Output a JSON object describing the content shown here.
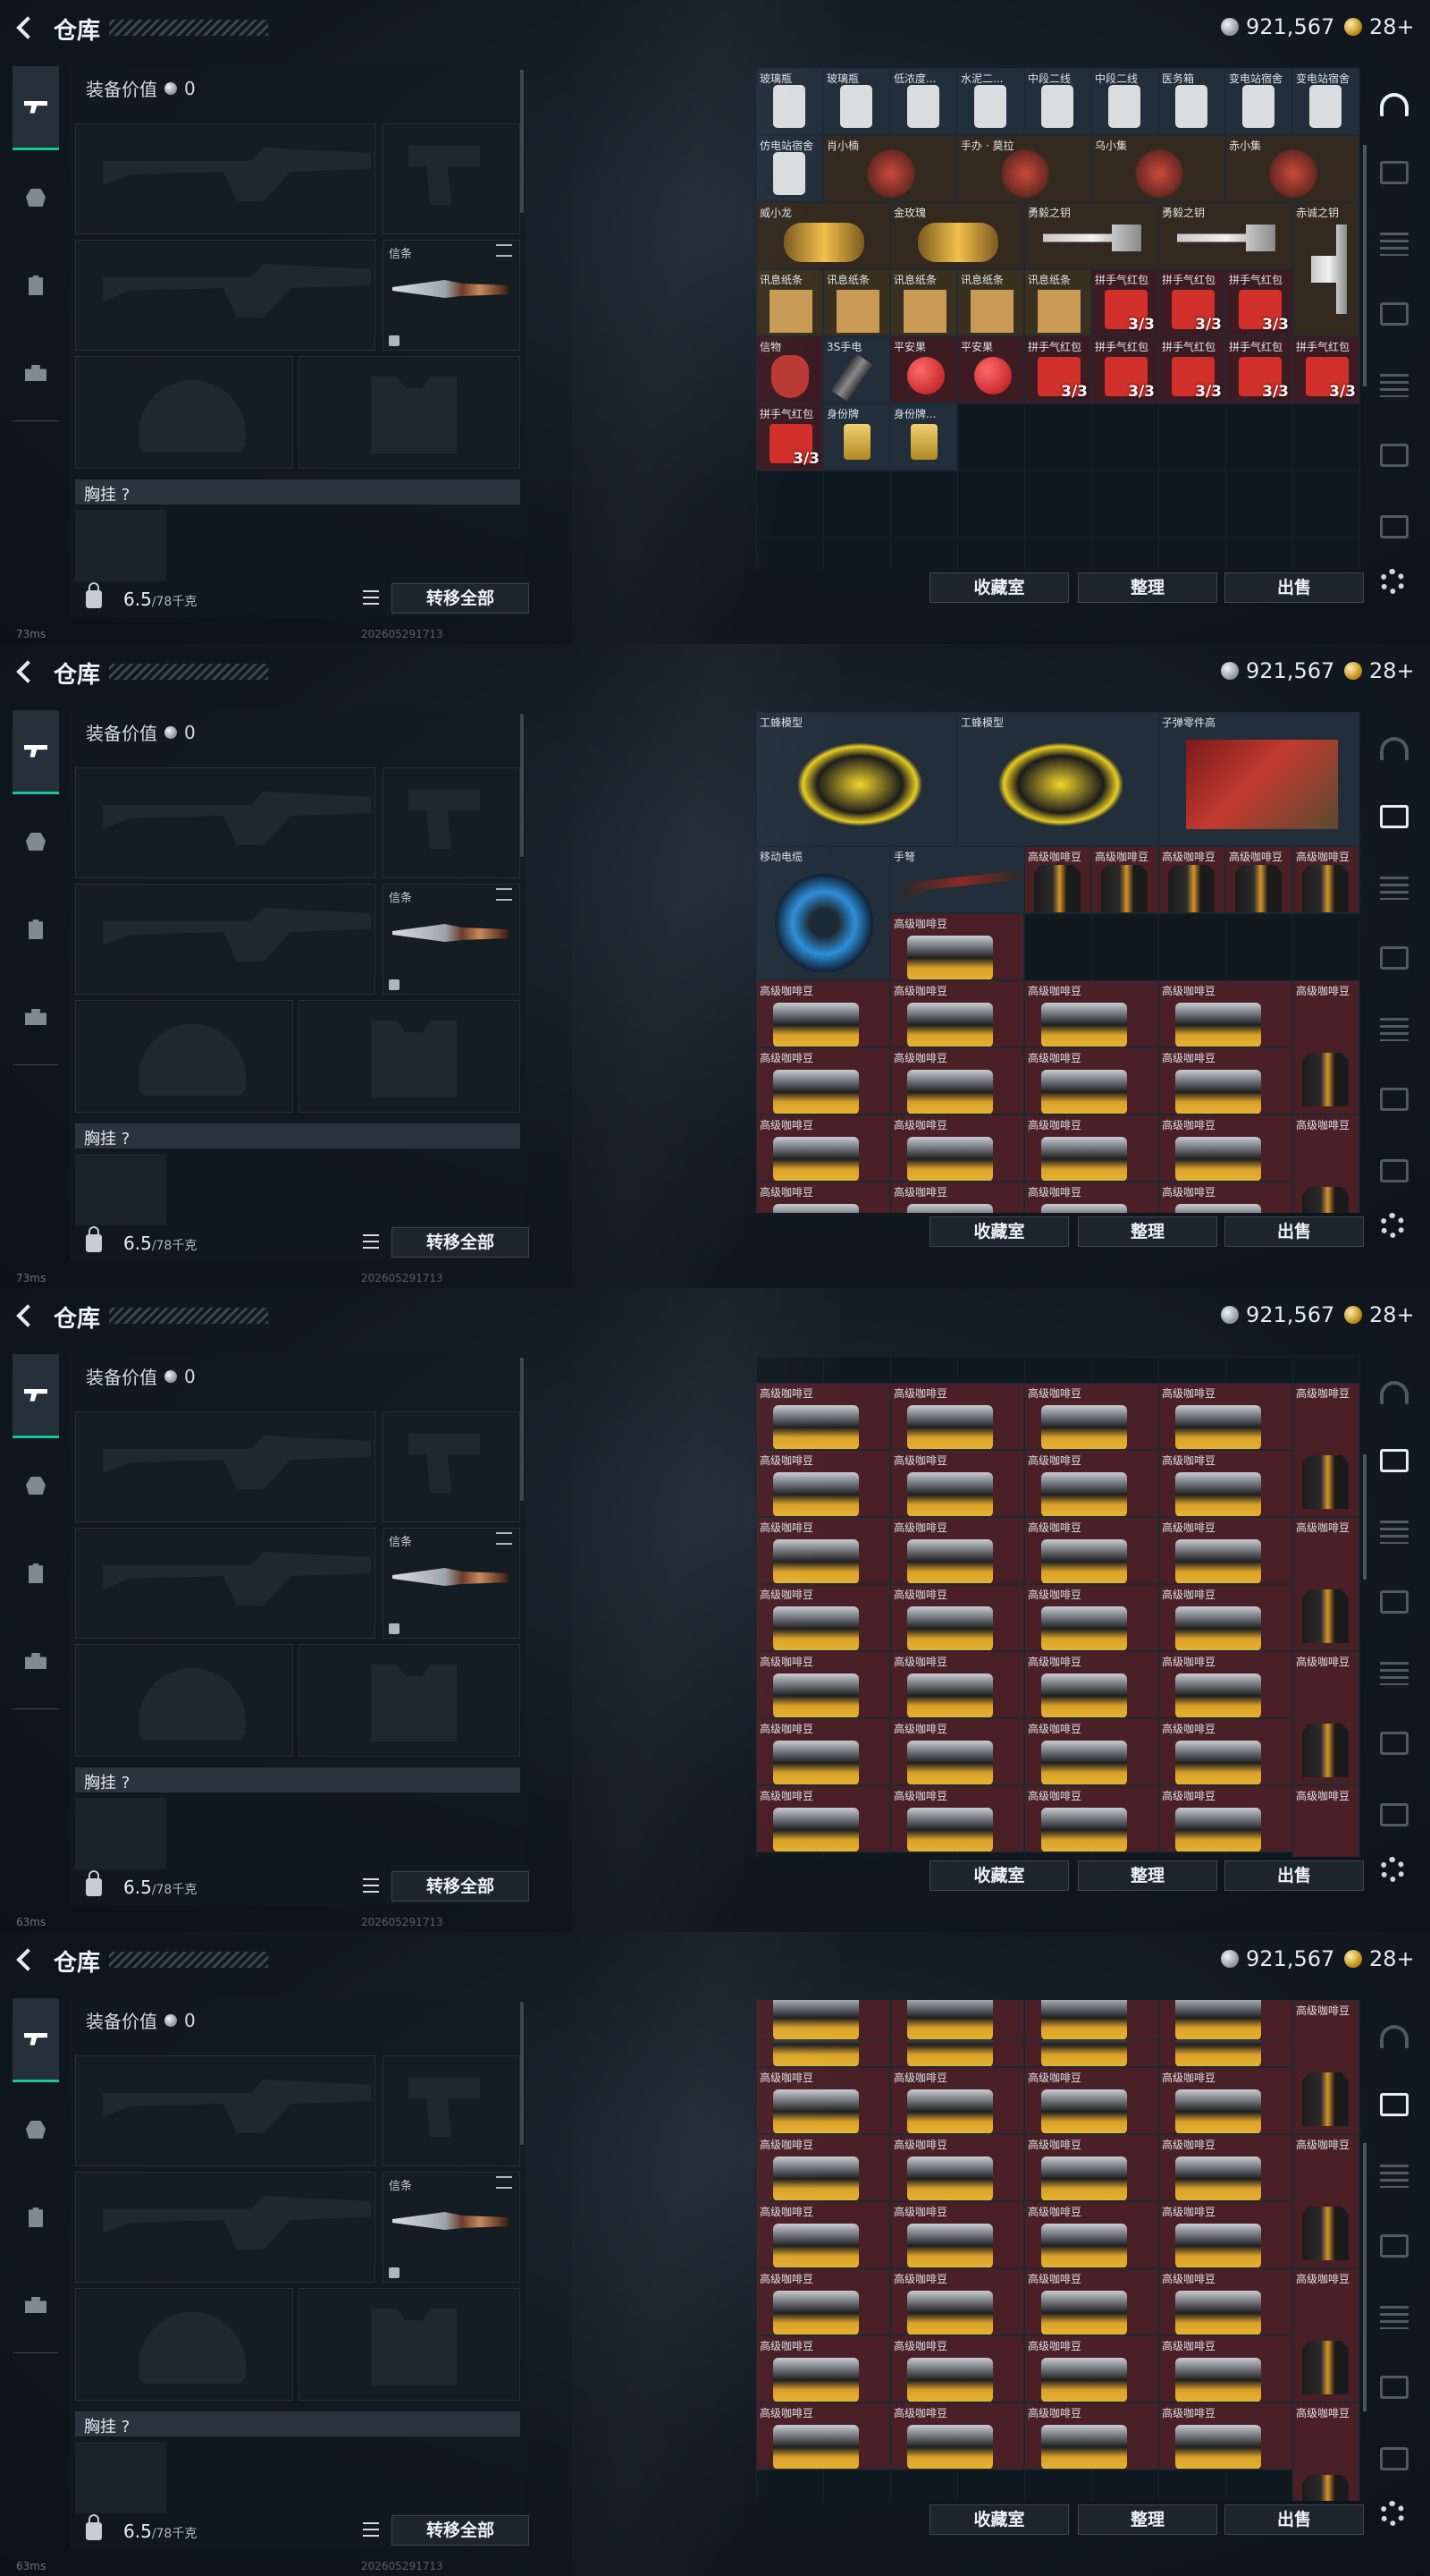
{
  "header": {
    "title": "仓库",
    "silver": "921,567",
    "gold": "28+"
  },
  "loadout": {
    "value_label": "装备价值",
    "value": "0",
    "melee_label": "信条",
    "chest_label": "胸挂 ?",
    "weight": "6.5",
    "weight_max": "/78千克",
    "transfer_all": "转移全部"
  },
  "footer": {
    "collection": "收藏室",
    "organize": "整理",
    "sell": "出售"
  },
  "status": {
    "ping": [
      "73ms",
      "73ms",
      "63ms",
      "63ms"
    ],
    "serial": "202605291713"
  },
  "stash_pages": [
    {
      "items": [
        {
          "name": "玻璃瓶",
          "r": 0,
          "c": 0,
          "kind": "bottle"
        },
        {
          "name": "玻璃瓶",
          "r": 0,
          "c": 1,
          "kind": "bottle"
        },
        {
          "name": "低浓度...",
          "r": 0,
          "c": 2,
          "kind": "bottle"
        },
        {
          "name": "水泥二...",
          "r": 0,
          "c": 3,
          "kind": "bottle"
        },
        {
          "name": "中段二线",
          "r": 0,
          "c": 4,
          "kind": "bottle"
        },
        {
          "name": "中段二线",
          "r": 0,
          "c": 5,
          "kind": "bottle"
        },
        {
          "name": "医务箱",
          "r": 0,
          "c": 6,
          "kind": "bottle"
        },
        {
          "name": "变电站宿舍",
          "r": 0,
          "c": 7,
          "kind": "bottle"
        },
        {
          "name": "变电站宿舍",
          "r": 0,
          "c": 8,
          "kind": "bottle"
        },
        {
          "name": "仿电站宿舍",
          "r": 1,
          "c": 0,
          "kind": "bottle"
        },
        {
          "name": "肖小楠",
          "r": 1,
          "c": 1,
          "w": 2,
          "kind": "figure"
        },
        {
          "name": "手办 · 莫拉",
          "r": 1,
          "c": 3,
          "w": 2,
          "kind": "figure"
        },
        {
          "name": "乌小集",
          "r": 1,
          "c": 5,
          "w": 2,
          "kind": "figure"
        },
        {
          "name": "赤小集",
          "r": 1,
          "c": 7,
          "w": 2,
          "kind": "figure"
        },
        {
          "name": "威小龙",
          "r": 2,
          "c": 0,
          "w": 2,
          "kind": "gold"
        },
        {
          "name": "金玫瑰",
          "r": 2,
          "c": 2,
          "w": 2,
          "kind": "gold"
        },
        {
          "name": "勇毅之钥",
          "r": 2,
          "c": 4,
          "w": 2,
          "kind": "key"
        },
        {
          "name": "勇毅之钥",
          "r": 2,
          "c": 6,
          "w": 2,
          "kind": "key"
        },
        {
          "name": "赤诚之钥",
          "r": 2,
          "c": 8,
          "h": 2,
          "kind": "key"
        },
        {
          "name": "讯息纸条",
          "r": 3,
          "c": 0,
          "kind": "paper"
        },
        {
          "name": "讯息纸条",
          "r": 3,
          "c": 1,
          "kind": "paper"
        },
        {
          "name": "讯息纸条",
          "r": 3,
          "c": 2,
          "kind": "paper"
        },
        {
          "name": "讯息纸条",
          "r": 3,
          "c": 3,
          "kind": "paper"
        },
        {
          "name": "讯息纸条",
          "r": 3,
          "c": 4,
          "kind": "paper"
        },
        {
          "name": "拼手气红包",
          "r": 3,
          "c": 5,
          "kind": "red",
          "count": "3/3"
        },
        {
          "name": "拼手气红包",
          "r": 3,
          "c": 6,
          "kind": "red",
          "count": "3/3"
        },
        {
          "name": "拼手气红包",
          "r": 3,
          "c": 7,
          "kind": "red",
          "count": "3/3"
        },
        {
          "name": "信物",
          "r": 4,
          "c": 0,
          "kind": "mask"
        },
        {
          "name": "3S手电",
          "r": 4,
          "c": 1,
          "kind": "torch"
        },
        {
          "name": "平安果",
          "r": 4,
          "c": 2,
          "kind": "apple"
        },
        {
          "name": "平安果",
          "r": 4,
          "c": 3,
          "kind": "apple"
        },
        {
          "name": "拼手气红包",
          "r": 4,
          "c": 4,
          "kind": "red",
          "count": "3/3"
        },
        {
          "name": "拼手气红包",
          "r": 4,
          "c": 5,
          "kind": "red",
          "count": "3/3"
        },
        {
          "name": "拼手气红包",
          "r": 4,
          "c": 6,
          "kind": "red",
          "count": "3/3"
        },
        {
          "name": "拼手气红包",
          "r": 4,
          "c": 7,
          "kind": "red",
          "count": "3/3"
        },
        {
          "name": "拼手气红包",
          "r": 4,
          "c": 8,
          "kind": "red",
          "count": "3/3"
        },
        {
          "name": "拼手气红包",
          "r": 5,
          "c": 0,
          "kind": "red",
          "count": "3/3"
        },
        {
          "name": "身份牌",
          "r": 5,
          "c": 1,
          "kind": "tag"
        },
        {
          "name": "身份牌...",
          "r": 5,
          "c": 2,
          "kind": "tag"
        }
      ]
    },
    {
      "items": [
        {
          "name": "工蜂模型",
          "r": 0,
          "c": 0,
          "w": 3,
          "h": 2,
          "kind": "wasp"
        },
        {
          "name": "工蜂模型",
          "r": 0,
          "c": 3,
          "w": 3,
          "h": 2,
          "kind": "wasp"
        },
        {
          "name": "子弹零件高",
          "r": 0,
          "c": 6,
          "w": 3,
          "h": 2,
          "kind": "parts"
        },
        {
          "name": "移动电缆",
          "r": 2,
          "c": 0,
          "w": 2,
          "h": 2,
          "kind": "reel"
        },
        {
          "name": "手弩",
          "r": 2,
          "c": 2,
          "w": 2,
          "kind": "crossbow"
        },
        {
          "name": "高级咖啡豆",
          "r": 2,
          "c": 4,
          "kind": "bag"
        },
        {
          "name": "高级咖啡豆",
          "r": 2,
          "c": 5,
          "kind": "bag"
        },
        {
          "name": "高级咖啡豆",
          "r": 2,
          "c": 6,
          "kind": "bag"
        },
        {
          "name": "高级咖啡豆",
          "r": 2,
          "c": 7,
          "kind": "bag"
        },
        {
          "name": "高级咖啡豆",
          "r": 2,
          "c": 8,
          "kind": "bag"
        },
        {
          "name": "高级咖啡豆",
          "r": 3,
          "c": 2,
          "w": 2,
          "kind": "bean"
        },
        {
          "name": "高级咖啡豆",
          "r": 4,
          "c": 0,
          "w": 2,
          "kind": "bean"
        },
        {
          "name": "高级咖啡豆",
          "r": 4,
          "c": 2,
          "w": 2,
          "kind": "bean"
        },
        {
          "name": "高级咖啡豆",
          "r": 4,
          "c": 4,
          "w": 2,
          "kind": "bean"
        },
        {
          "name": "高级咖啡豆",
          "r": 4,
          "c": 6,
          "w": 2,
          "kind": "bean"
        },
        {
          "name": "高级咖啡豆",
          "r": 4,
          "c": 8,
          "h": 2,
          "kind": "bag"
        },
        {
          "name": "高级咖啡豆",
          "r": 5,
          "c": 0,
          "w": 2,
          "kind": "bean"
        },
        {
          "name": "高级咖啡豆",
          "r": 5,
          "c": 2,
          "w": 2,
          "kind": "bean"
        },
        {
          "name": "高级咖啡豆",
          "r": 5,
          "c": 4,
          "w": 2,
          "kind": "bean"
        },
        {
          "name": "高级咖啡豆",
          "r": 5,
          "c": 6,
          "w": 2,
          "kind": "bean"
        },
        {
          "name": "高级咖啡豆",
          "r": 6,
          "c": 0,
          "w": 2,
          "kind": "bean"
        },
        {
          "name": "高级咖啡豆",
          "r": 6,
          "c": 2,
          "w": 2,
          "kind": "bean"
        },
        {
          "name": "高级咖啡豆",
          "r": 6,
          "c": 4,
          "w": 2,
          "kind": "bean"
        },
        {
          "name": "高级咖啡豆",
          "r": 6,
          "c": 6,
          "w": 2,
          "kind": "bean"
        },
        {
          "name": "高级咖啡豆",
          "r": 6,
          "c": 8,
          "h": 2,
          "kind": "bag"
        },
        {
          "name": "高级咖啡豆",
          "r": 7,
          "c": 0,
          "w": 2,
          "kind": "bean"
        },
        {
          "name": "高级咖啡豆",
          "r": 7,
          "c": 2,
          "w": 2,
          "kind": "bean"
        },
        {
          "name": "高级咖啡豆",
          "r": 7,
          "c": 4,
          "w": 2,
          "kind": "bean"
        },
        {
          "name": "高级咖啡豆",
          "r": 7,
          "c": 6,
          "w": 2,
          "kind": "bean"
        }
      ]
    },
    {
      "pattern": "beans",
      "label": "高级咖啡豆",
      "rows": 7,
      "top_label": true
    },
    {
      "pattern": "beans",
      "label": "高级咖啡豆",
      "rows": 7,
      "top_label": false
    }
  ]
}
